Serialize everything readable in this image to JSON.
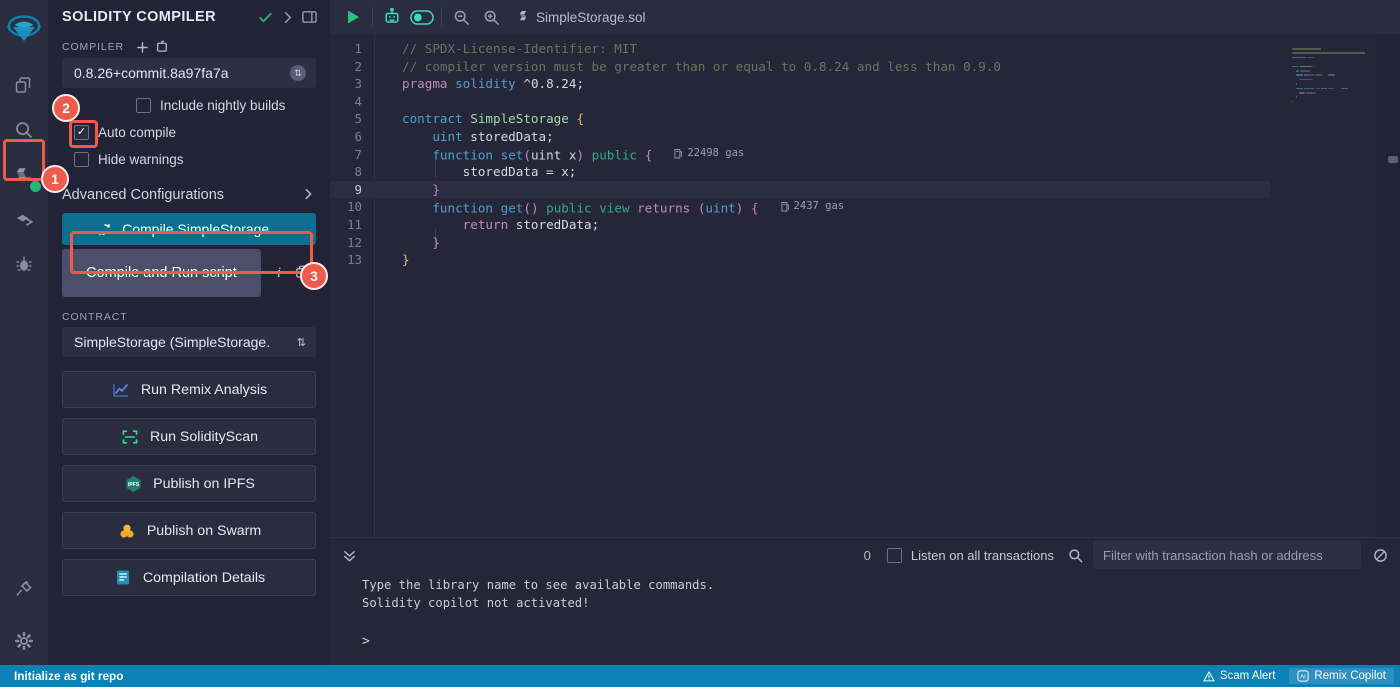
{
  "activity_bar": {
    "logo": "remix-logo",
    "items": [
      {
        "name": "file-explorer-icon",
        "label": "File explorer"
      },
      {
        "name": "search-icon",
        "label": "Search in files"
      },
      {
        "name": "solidity-compiler-icon",
        "label": "Solidity compiler",
        "active": true
      },
      {
        "name": "deploy-run-icon",
        "label": "Deploy & run transactions"
      },
      {
        "name": "debugger-icon",
        "label": "Debugger"
      }
    ],
    "bottom_items": [
      {
        "name": "plugin-manager-icon",
        "label": "Plugin manager"
      },
      {
        "name": "settings-icon",
        "label": "Settings"
      }
    ]
  },
  "panel": {
    "title": "SOLIDITY COMPILER",
    "header_icons": [
      "check-icon",
      "chevron-right-icon",
      "layout-panel-icon"
    ],
    "compiler_label": "COMPILER",
    "compiler_version": "0.8.26+commit.8a97fa7a",
    "checkboxes": [
      {
        "label": "Include nightly builds",
        "checked": false
      },
      {
        "label": "Auto compile",
        "checked": true
      },
      {
        "label": "Hide warnings",
        "checked": false
      }
    ],
    "advanced_configurations": "Advanced Configurations",
    "compile_button": "Compile SimpleStorage...",
    "compile_and_run_script": "Compile and Run script",
    "contract_label": "CONTRACT",
    "contract_value": "SimpleStorage (SimpleStorage.",
    "actions": [
      {
        "label": "Run Remix Analysis",
        "icon": "analysis-chart-icon"
      },
      {
        "label": "Run SolidityScan",
        "icon": "scan-brackets-icon"
      },
      {
        "label": "Publish on IPFS",
        "icon": "ipfs-icon"
      },
      {
        "label": "Publish on Swarm",
        "icon": "swarm-icon"
      },
      {
        "label": "Compilation Details",
        "icon": "details-icon"
      }
    ]
  },
  "editor": {
    "toolbar_icons": [
      "run-play-icon",
      "robot-icon",
      "toggle-on-icon",
      "zoom-out-icon",
      "zoom-in-icon"
    ],
    "tab_name": "SimpleStorage.sol",
    "tab_icon": "solidity-file-icon",
    "active_line": 9,
    "lines": [
      {
        "n": 1,
        "tokens": [
          {
            "t": "// SPDX-License-Identifier: MIT",
            "c": "s-com"
          }
        ]
      },
      {
        "n": 2,
        "tokens": [
          {
            "t": "// compiler version must be greater than or equal to 0.8.24 and less than 0.9.0",
            "c": "s-com"
          }
        ]
      },
      {
        "n": 3,
        "tokens": [
          {
            "t": "pragma",
            "c": "s-kw"
          },
          {
            "t": " ",
            "c": "s-id"
          },
          {
            "t": "solidity",
            "c": "s-kw2"
          },
          {
            "t": " ",
            "c": "s-id"
          },
          {
            "t": "^0.8.24",
            "c": "s-id"
          },
          {
            "t": ";",
            "c": "s-id"
          }
        ]
      },
      {
        "n": 4,
        "tokens": []
      },
      {
        "n": 5,
        "tokens": [
          {
            "t": "contract",
            "c": "s-kw2"
          },
          {
            "t": " ",
            "c": "s-id"
          },
          {
            "t": "SimpleStorage",
            "c": "s-ctr"
          },
          {
            "t": " ",
            "c": "s-id"
          },
          {
            "t": "{",
            "c": "s-br"
          }
        ]
      },
      {
        "n": 6,
        "tokens": [
          {
            "t": "    ",
            "c": "s-id"
          },
          {
            "t": "uint",
            "c": "s-kw2"
          },
          {
            "t": " storedData;",
            "c": "s-id"
          }
        ]
      },
      {
        "n": 7,
        "tokens": [
          {
            "t": "    ",
            "c": "s-id"
          },
          {
            "t": "function",
            "c": "s-kw2"
          },
          {
            "t": " ",
            "c": "s-id"
          },
          {
            "t": "set",
            "c": "s-fn"
          },
          {
            "t": "(",
            "c": "s-brp"
          },
          {
            "t": "uint x",
            "c": "s-id"
          },
          {
            "t": ")",
            "c": "s-brp"
          },
          {
            "t": " ",
            "c": "s-id"
          },
          {
            "t": "public",
            "c": "s-vis"
          },
          {
            "t": " ",
            "c": "s-id"
          },
          {
            "t": "{",
            "c": "s-brp"
          }
        ],
        "gas": "22498 gas"
      },
      {
        "n": 8,
        "tokens": [
          {
            "t": "        storedData = x;",
            "c": "s-id"
          }
        ]
      },
      {
        "n": 9,
        "tokens": [
          {
            "t": "    ",
            "c": "s-id"
          },
          {
            "t": "}",
            "c": "s-brp"
          }
        ]
      },
      {
        "n": 10,
        "tokens": [
          {
            "t": "    ",
            "c": "s-id"
          },
          {
            "t": "function",
            "c": "s-kw2"
          },
          {
            "t": " ",
            "c": "s-id"
          },
          {
            "t": "get",
            "c": "s-fn"
          },
          {
            "t": "()",
            "c": "s-brp"
          },
          {
            "t": " ",
            "c": "s-id"
          },
          {
            "t": "public",
            "c": "s-vis"
          },
          {
            "t": " ",
            "c": "s-id"
          },
          {
            "t": "view",
            "c": "s-vis"
          },
          {
            "t": " ",
            "c": "s-id"
          },
          {
            "t": "returns",
            "c": "s-kw"
          },
          {
            "t": " ",
            "c": "s-id"
          },
          {
            "t": "(",
            "c": "s-brp"
          },
          {
            "t": "uint",
            "c": "s-kw2"
          },
          {
            "t": ")",
            "c": "s-brp"
          },
          {
            "t": " ",
            "c": "s-id"
          },
          {
            "t": "{",
            "c": "s-brp"
          }
        ],
        "gas": "2437 gas"
      },
      {
        "n": 11,
        "tokens": [
          {
            "t": "        ",
            "c": "s-id"
          },
          {
            "t": "return",
            "c": "s-kw"
          },
          {
            "t": " storedData;",
            "c": "s-id"
          }
        ]
      },
      {
        "n": 12,
        "tokens": [
          {
            "t": "    ",
            "c": "s-id"
          },
          {
            "t": "}",
            "c": "s-brp"
          }
        ]
      },
      {
        "n": 13,
        "tokens": [
          {
            "t": "}",
            "c": "s-br"
          }
        ]
      }
    ]
  },
  "terminal": {
    "collapse_icon": "chevron-double-down-icon",
    "count": "0",
    "listen_label": "Listen on all transactions",
    "listen_checked": false,
    "search_icon": "search-icon",
    "filter_placeholder": "Filter with transaction hash or address",
    "filter_value": "",
    "clear_icon": "ban-icon",
    "lines": [
      "Type the library name to see available commands.",
      "Solidity copilot not activated!"
    ],
    "prompt": ">"
  },
  "status_bar": {
    "left_label": "Initialize as git repo",
    "scam_alert": "Scam Alert",
    "scam_icon": "warning-triangle-icon",
    "copilot": "Remix Copilot",
    "copilot_icon": "ai-icon"
  },
  "annotations": [
    {
      "id": "1",
      "target": "solidity-compiler-icon"
    },
    {
      "id": "2",
      "target": "auto-compile-checkbox"
    },
    {
      "id": "3",
      "target": "compile-button"
    }
  ],
  "colors": {
    "accent": "#0b82b5",
    "compile_button": "#0d6e91",
    "annotation": "#ef5a4c",
    "success": "#22b573",
    "panel_bg": "#222336",
    "editor_bg": "#252739"
  }
}
